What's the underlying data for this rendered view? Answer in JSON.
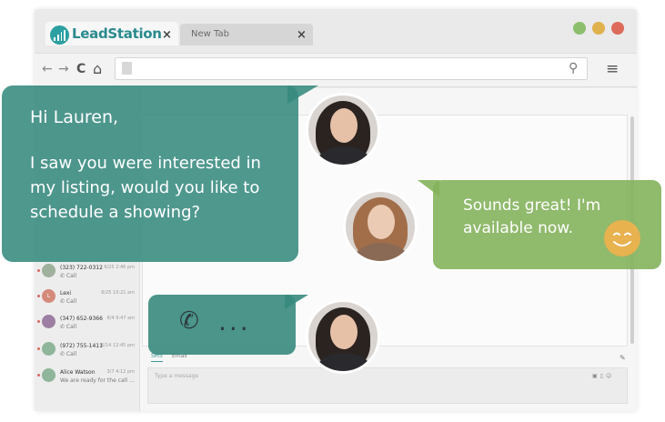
{
  "browser": {
    "tabs": [
      {
        "label": "LeadStation",
        "close": "×"
      },
      {
        "label": "New Tab",
        "close": "×"
      }
    ],
    "window_buttons": {
      "green": "#8cbe6e",
      "yellow": "#e0b24e",
      "red": "#dd6a5a"
    },
    "nav": {
      "back": "←",
      "forward": "→",
      "reload": "C",
      "home": "⌂"
    },
    "menu": "≡"
  },
  "contacts": [
    {
      "initial": "",
      "name": "(323) 722-0312",
      "sub": "✆ Call",
      "time": "6/25 2:46 pm",
      "color": "#9fb09c"
    },
    {
      "initial": "L",
      "name": "Lexi",
      "sub": "✆ Call",
      "time": "6/25 10:21 am",
      "color": "#d48a7a"
    },
    {
      "initial": "",
      "name": "(347) 652-9366",
      "sub": "✆ Call",
      "time": "6/4 9:47 am",
      "color": "#9d7fa3"
    },
    {
      "initial": "",
      "name": "(972) 755-1411",
      "sub": "✆ Call",
      "time": "6/14 12:45 pm",
      "color": "#8fb59a"
    },
    {
      "initial": "",
      "name": "Alice Watson",
      "sub": "We are ready for the call scheduled...",
      "time": "3/7 4:12 pm",
      "color": "#8fb59a"
    }
  ],
  "composer": {
    "tab_sms": "SMS",
    "tab_email": "Email",
    "placeholder": "Type a message"
  },
  "bubbles": {
    "greeting": "Hi Lauren,",
    "message": "I saw you were interested in my listing, would you like to schedule a showing?",
    "reply": "Sounds great! I'm available now.",
    "call_icon": "✆",
    "call_dots": "..."
  },
  "colors": {
    "teal": "#378a7e",
    "green": "#84b25c",
    "brand": "#2b9fa2",
    "smiley": "#e8b24f"
  }
}
